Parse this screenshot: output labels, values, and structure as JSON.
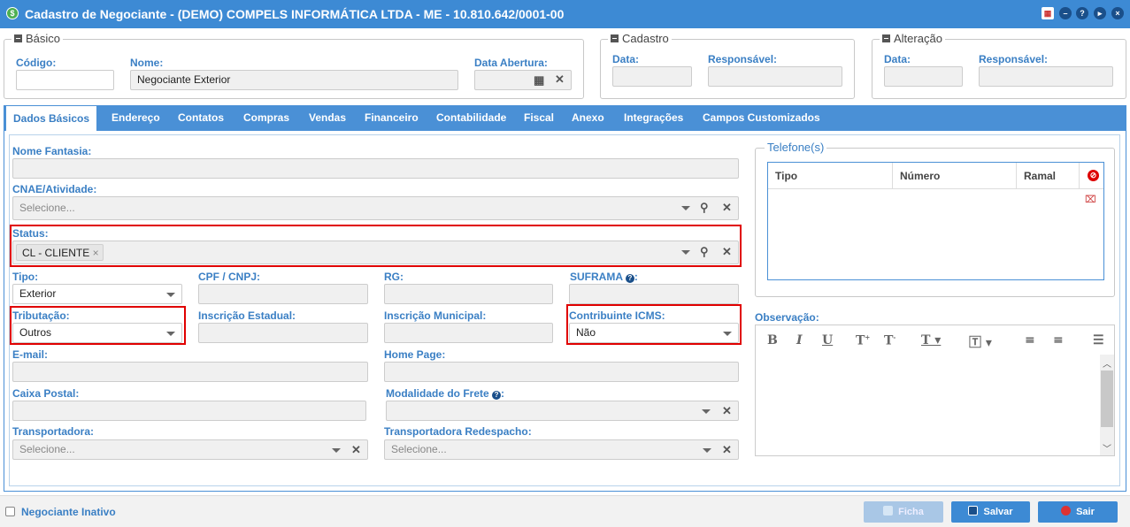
{
  "window": {
    "title": "Cadastro de Negociante - (DEMO) COMPELS INFORMÁTICA LTDA - ME - 10.810.642/0001-00",
    "icons": [
      "calendar-icon",
      "minimize-icon",
      "help-icon",
      "forward-icon",
      "close-icon"
    ]
  },
  "basico": {
    "legend": "Básico",
    "codigo_label": "Código:",
    "codigo_value": "",
    "nome_label": "Nome:",
    "nome_value": "Negociante Exterior",
    "data_abertura_label": "Data Abertura:",
    "data_abertura_value": ""
  },
  "cadastro": {
    "legend": "Cadastro",
    "data_label": "Data:",
    "responsavel_label": "Responsável:"
  },
  "alteracao": {
    "legend": "Alteração",
    "data_label": "Data:",
    "responsavel_label": "Responsável:"
  },
  "tabs": [
    {
      "label": "Dados Básicos",
      "active": true
    },
    {
      "label": "Endereço"
    },
    {
      "label": "Contatos"
    },
    {
      "label": "Compras"
    },
    {
      "label": "Vendas"
    },
    {
      "label": "Financeiro"
    },
    {
      "label": "Contabilidade"
    },
    {
      "label": "Fiscal"
    },
    {
      "label": "Anexo"
    },
    {
      "label": "Integrações"
    },
    {
      "label": "Campos Customizados"
    }
  ],
  "form": {
    "nome_fantasia_label": "Nome Fantasia:",
    "cnae_label": "CNAE/Atividade:",
    "cnae_placeholder": "Selecione...",
    "status_label": "Status:",
    "status_tag": "CL - CLIENTE",
    "tipo_label": "Tipo:",
    "tipo_value": "Exterior",
    "cpf_label": "CPF / CNPJ:",
    "rg_label": "RG:",
    "suframa_label": "SUFRAMA",
    "suframa_suffix": ":",
    "tributacao_label": "Tributação:",
    "tributacao_value": "Outros",
    "ie_label": "Inscrição Estadual:",
    "im_label": "Inscrição Municipal:",
    "icms_label": "Contribuinte ICMS:",
    "icms_value": "Não",
    "email_label": "E-mail:",
    "homepage_label": "Home Page:",
    "caixa_postal_label": "Caixa Postal:",
    "frete_label": "Modalidade do Frete",
    "frete_suffix": ":",
    "transportadora_label": "Transportadora:",
    "transportadora_placeholder": "Selecione...",
    "redespacho_label": "Transportadora Redespacho:",
    "redespacho_placeholder": "Selecione..."
  },
  "telefones": {
    "legend": "Telefone(s)",
    "columns": [
      "Tipo",
      "Número",
      "Ramal"
    ]
  },
  "observacao": {
    "label": "Observação:"
  },
  "footer": {
    "inativo_label": "Negociante Inativo",
    "ficha_label": "Ficha",
    "salvar_label": "Salvar",
    "sair_label": "Sair"
  },
  "colors": {
    "titlebar": "#3d8ad4",
    "accent": "#3a7fc4",
    "highlight": "#e00000",
    "sair": "#3d8ad4"
  }
}
